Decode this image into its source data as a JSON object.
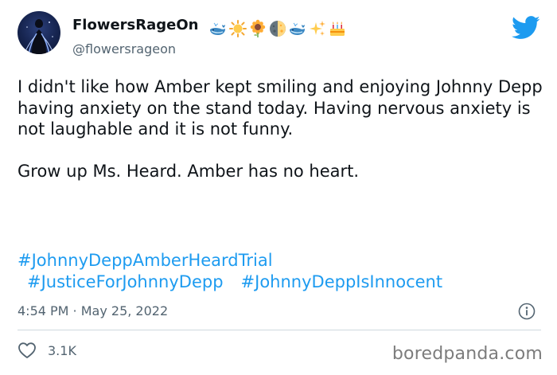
{
  "tweet": {
    "author": {
      "display_name": "FlowersRageOn",
      "handle": "@flowersrageon",
      "avatar_icon": "avatar-dark-figure",
      "name_emojis": [
        "whale-icon",
        "sun-icon",
        "sunflower-icon",
        "moon-icon",
        "whale-icon",
        "sparkles-icon",
        "crown-icon"
      ]
    },
    "body": "I didn't like how Amber kept smiling and enjoying Johnny Depp having anxiety on the stand today. Having nervous anxiety is not laughable and it is not funny.\n\nGrow up Ms. Heard. Amber has no heart.",
    "hashtags": [
      "#JohnnyDeppAmberHeardTrial",
      "#JusticeForJohnnyDepp",
      "#JohnnyDeppIsInnocent"
    ],
    "timestamp": "4:54 PM · May 25, 2022",
    "likes": "3.1K"
  },
  "watermark": "boredpanda.com",
  "colors": {
    "text": "#0f1419",
    "secondary": "#536471",
    "accent": "#1d9bf0",
    "divider": "#cfd9de"
  }
}
